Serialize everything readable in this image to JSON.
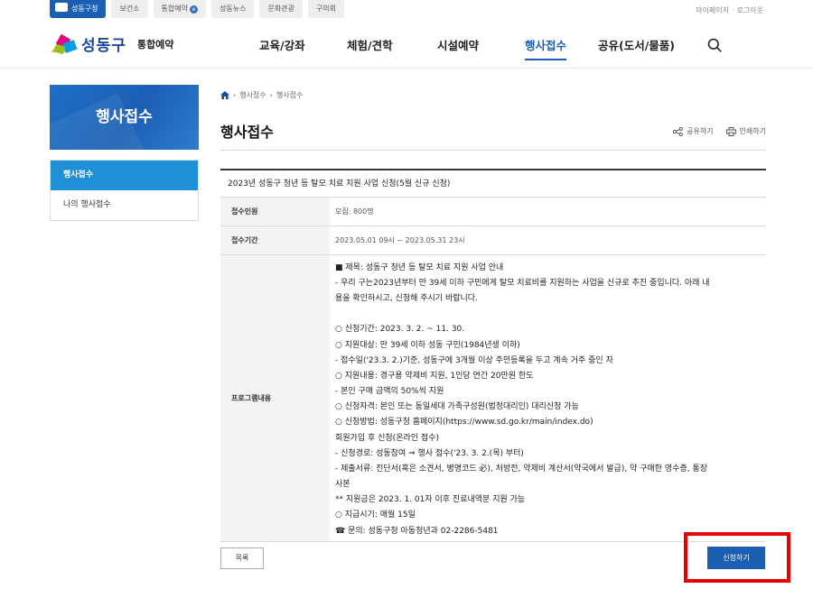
{
  "top": {
    "tabs": [
      "성동구청",
      "보건소",
      "통합예약",
      "성동뉴스",
      "문화관광",
      "구의회"
    ],
    "tab_badge": "e",
    "util": [
      "마이페이지",
      "로그아웃"
    ]
  },
  "header": {
    "logo_name": "성동구",
    "logo_sub": "통합예약",
    "nav": [
      "교육/강좌",
      "체험/견학",
      "시설예약",
      "행사접수",
      "공유(도서/물품)"
    ]
  },
  "sidebar": {
    "title": "행사접수",
    "items": [
      "행사접수",
      "나의 행사접수"
    ]
  },
  "breadcrumb": [
    "행사접수",
    "행사접수"
  ],
  "page": {
    "title": "행사접수",
    "share": "공유하기",
    "print": "인쇄하기"
  },
  "table": {
    "heading": "2023년 성동구 청년 등 탈모 치료 지원 사업 신청(5월 신규 신청)",
    "rows": [
      {
        "label": "접수인원",
        "value": "모집: 800명"
      },
      {
        "label": "접수기간",
        "value": "2023.05.01 09시 ~ 2023.05.31 23시"
      }
    ],
    "program_label": "프로그램내용",
    "program_lines": [
      "■ 제목: 성동구 청년 등 탈모 치료 지원 사업 안내",
      "- 우리 구는2023년부터 만 39세 이하 구민에게 탈모 치료비를 지원하는 사업을 신규로 추진 중입니다. 아래 내",
      "용을 확인하시고, 신청해 주시기 바랍니다.",
      "",
      "○ 신청기간: 2023. 3. 2. ~ 11. 30.",
      "○ 지원대상: 만 39세 이하 성동 구민(1984년생 이하)",
      "- 접수일('23.3. 2.)기준, 성동구에 3개월 이상 주민등록을 두고 계속 거주 중인 자",
      "○ 지원내용: 경구용 약제비 지원, 1인당 연간 20만원 한도",
      "- 본인 구매 금액의 50%씩 지원",
      "○ 신청자격: 본인 또는 동일세대 가족구성원(법정대리인) 대리신청 가능",
      "○ 신청방법: 성동구청 홈페이지(https://www.sd.go.kr/main/index.do)",
      "회원가입 후 신청(온라인 접수)",
      "- 신청경로: 성동참여 ⇒ 행사 접수('23. 3. 2.(목) 부터)",
      "- 제출서류: 진단서(혹은 소견서, 병명코드 必), 처방전, 약제비 계산서(약국에서 발급), 약 구매한 영수증, 통장",
      "사본",
      "** 지원금은 2023. 1. 01자 이후 진료내역분 지원 가능",
      "○ 지급시기: 매월 15일",
      "☎ 문의: 성동구청 아동청년과 02-2286-5481"
    ]
  },
  "buttons": {
    "list": "목록",
    "apply": "신청하기"
  }
}
